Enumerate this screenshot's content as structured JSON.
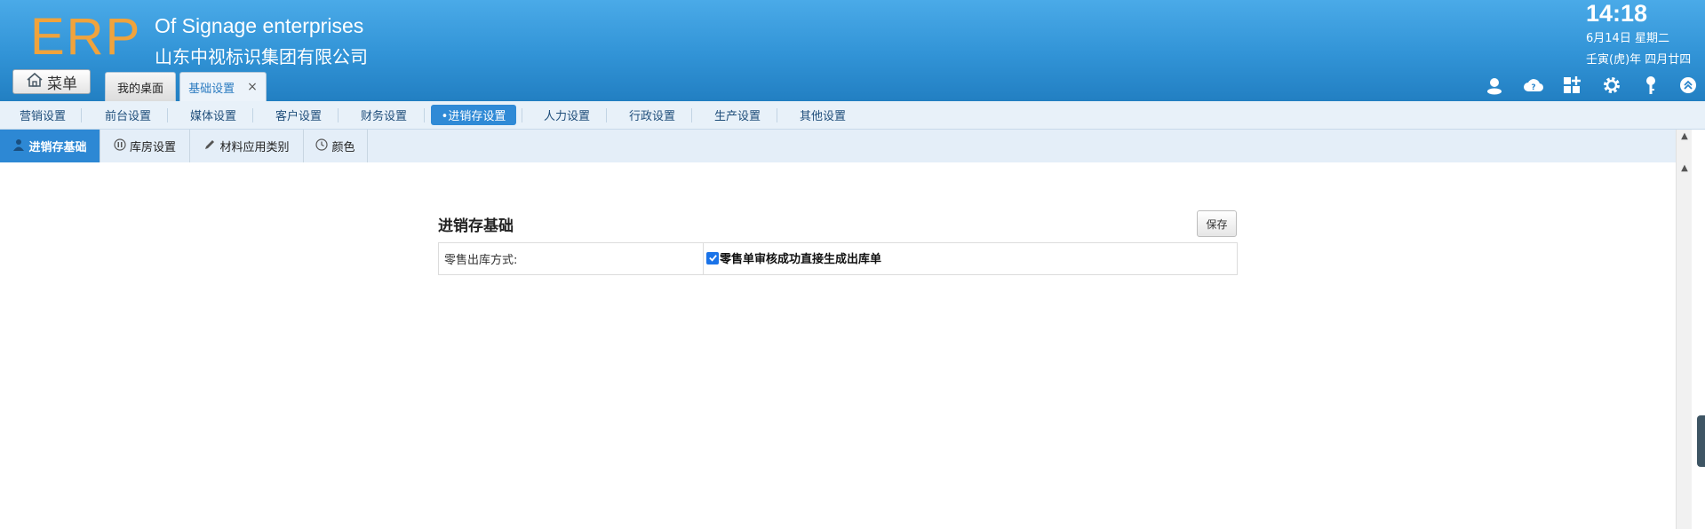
{
  "header": {
    "logo": "ERP",
    "company_en": "Of Signage enterprises",
    "company_cn": "山东中视标识集团有限公司",
    "time": "14:18",
    "date": "6月14日 星期二",
    "lunar_date": "壬寅(虎)年 四月廿四",
    "menu_label": "菜单",
    "icons": [
      "user-icon",
      "cloud-help-icon",
      "grid-plus-icon",
      "gear-icon",
      "key-icon",
      "collapse-up-icon"
    ]
  },
  "tabs": [
    {
      "label": "我的桌面"
    },
    {
      "label": "基础设置",
      "close": "×",
      "active": true
    }
  ],
  "main_nav": [
    {
      "label": "营销设置"
    },
    {
      "label": "前台设置"
    },
    {
      "label": "媒体设置"
    },
    {
      "label": "客户设置"
    },
    {
      "label": "财务设置"
    },
    {
      "label": "•进销存设置",
      "active": true
    },
    {
      "label": "人力设置"
    },
    {
      "label": "行政设置"
    },
    {
      "label": "生产设置"
    },
    {
      "label": "其他设置"
    }
  ],
  "sub_nav": [
    {
      "label": "进销存基础",
      "active": true,
      "icon": "person-icon"
    },
    {
      "label": "库房设置",
      "icon": "pause-circle-icon"
    },
    {
      "label": "材料应用类别",
      "icon": "pencil-icon"
    },
    {
      "label": "颜色",
      "icon": "clock-icon"
    }
  ],
  "form": {
    "title": "进销存基础",
    "save_label": "保存",
    "rows": [
      {
        "label": "零售出库方式:",
        "checkbox_label": "零售单审核成功直接生成出库单",
        "checked": true
      }
    ]
  },
  "colors": {
    "header_top": "#4aaae8",
    "header_bottom": "#227fc2",
    "logo": "#f0a33c",
    "active_nav": "#2f8ad6",
    "checkbox": "#1a73e8"
  }
}
